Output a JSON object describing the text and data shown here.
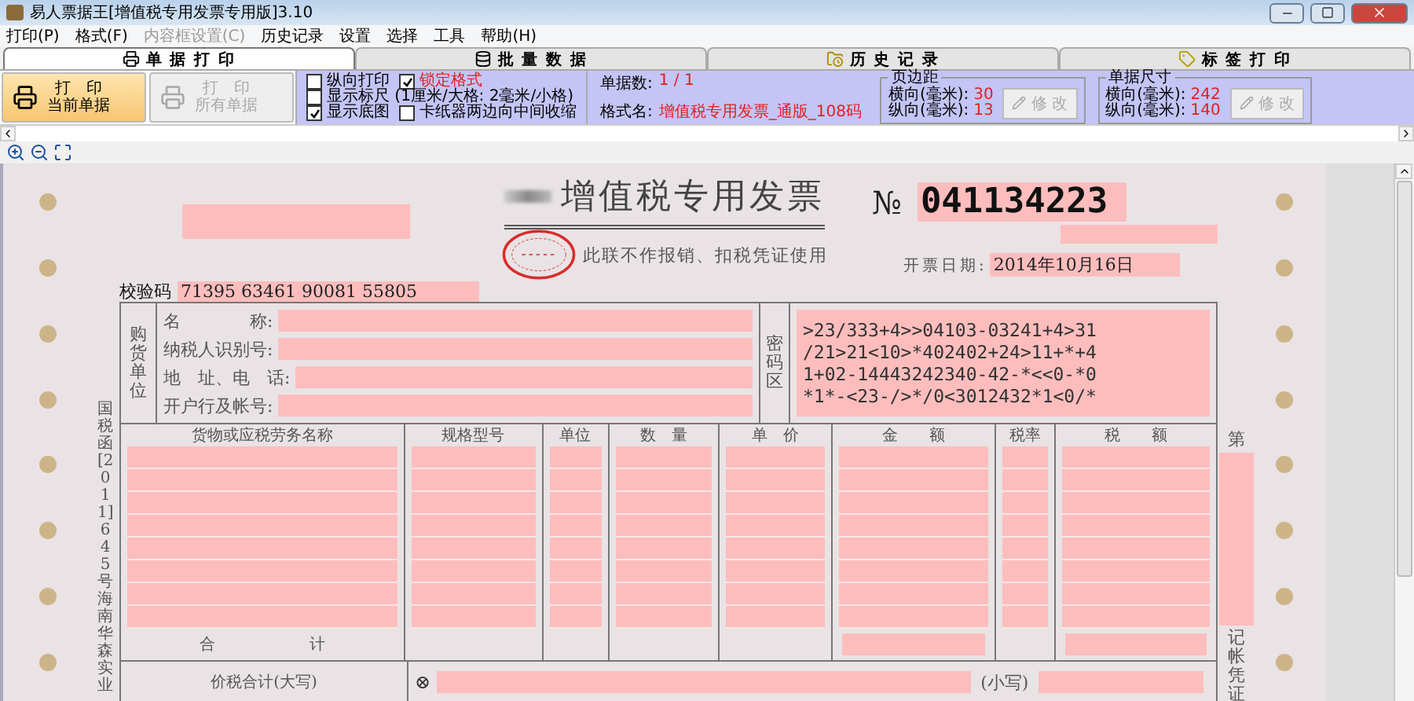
{
  "window": {
    "title": "易人票据王[增值税专用发票专用版]3.10"
  },
  "menu": [
    {
      "label": "打印(P)",
      "disabled": false
    },
    {
      "label": "格式(F)",
      "disabled": false
    },
    {
      "label": "内容框设置(C)",
      "disabled": true
    },
    {
      "label": "历史记录",
      "disabled": false
    },
    {
      "label": "设置",
      "disabled": false
    },
    {
      "label": "选择",
      "disabled": false
    },
    {
      "label": "工具",
      "disabled": false
    },
    {
      "label": "帮助(H)",
      "disabled": false
    }
  ],
  "tabs": [
    {
      "label": "单 据 打 印",
      "selected": true
    },
    {
      "label": "批 量 数 据",
      "selected": false
    },
    {
      "label": "历 史 记 录",
      "selected": false
    },
    {
      "label": "标 签 打 印",
      "selected": false
    }
  ],
  "toolbar": {
    "print_buttons": [
      {
        "line1": "打　印",
        "line2": "当前单据",
        "disabled": false
      },
      {
        "line1": "打　印",
        "line2": "所有单据",
        "disabled": true
      }
    ],
    "options": [
      {
        "label": "纵向打印",
        "checked": false,
        "emphasis": false
      },
      {
        "label": "锁定格式",
        "checked": true,
        "emphasis": true
      },
      {
        "label": "显示标尺 (1厘米/大格: 2毫米/小格)",
        "checked": false,
        "emphasis": false
      },
      {
        "label": "显示底图",
        "checked": true,
        "emphasis": false
      },
      {
        "label": "卡纸器两边向中间收缩",
        "checked": false,
        "emphasis": false
      }
    ],
    "count_label": "单据数:",
    "count_value": "1 / 1",
    "format_label": "格式名:",
    "format_value": "增值税专用发票_通版_108码",
    "groups": [
      {
        "title": "页边距",
        "rows": [
          {
            "label": "横向(毫米):",
            "value": "30"
          },
          {
            "label": "纵向(毫米):",
            "value": "13"
          }
        ],
        "button": {
          "label": "修 改",
          "disabled": true
        }
      },
      {
        "title": "单据尺寸",
        "rows": [
          {
            "label": "横向(毫米):",
            "value": "242"
          },
          {
            "label": "纵向(毫米):",
            "value": "140"
          }
        ],
        "button": {
          "label": "修 改",
          "disabled": true
        }
      }
    ]
  },
  "invoice": {
    "title": "增值税专用发票",
    "subtitle": "此联不作报销、扣税凭证使用",
    "number_symbol": "№",
    "number": "041134223",
    "date_label": "开票日期:",
    "date": "2014年10月16日",
    "check_code_label": "校验码",
    "check_code": "71395 63461 90081 55805",
    "buyer_label": "购货单位",
    "buyer_fields": [
      "名　　　　称:",
      "纳税人识别号:",
      "地　址、电　话:",
      "开户行及帐号:"
    ],
    "cipher_label": "密码区",
    "cipher_lines": [
      ">23/333+4>>04103-03241+4>31",
      "/21>21<10>*402402+24>11+*+4",
      "1+02-14443242340-42-*<<0-*0",
      "*1*-<23-/>*/0<3012432*1<0/*"
    ],
    "columns": [
      {
        "label": "货物或应税劳务名称",
        "total": false
      },
      {
        "label": "规格型号",
        "total": false
      },
      {
        "label": "单位",
        "total": false
      },
      {
        "label": "数　量",
        "total": false
      },
      {
        "label": "单　价",
        "total": false
      },
      {
        "label": "金　　额",
        "total": true
      },
      {
        "label": "税率",
        "total": false
      },
      {
        "label": "税　　额",
        "total": true
      }
    ],
    "total_label": "合　　　　　　计",
    "grand_total_label": "价税合计(大写)",
    "grand_total_mark": "⊗",
    "small_label": "(小写)",
    "side_text": "国税函[2011]645号海南华森实业",
    "copy_top": "第",
    "copy_bottom": "记帐凭证"
  }
}
